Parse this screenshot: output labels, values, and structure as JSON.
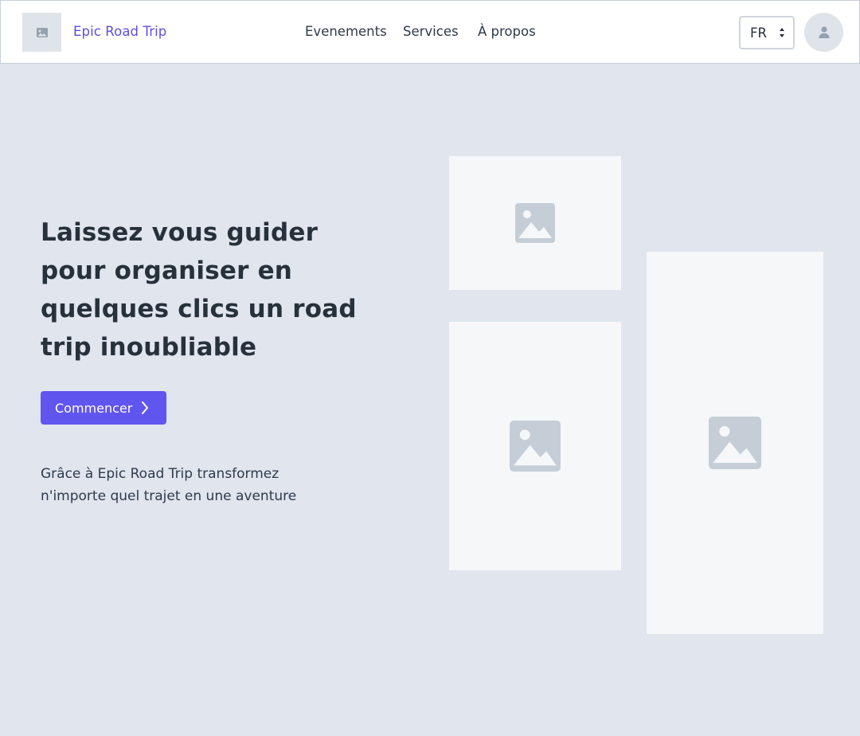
{
  "header": {
    "brand": "Epic Road Trip",
    "logo_icon": "image-placeholder-icon",
    "nav": [
      {
        "label": "Evenements"
      },
      {
        "label": "Services"
      },
      {
        "label": "À propos"
      }
    ],
    "language": {
      "selected": "FR",
      "icon": "sort-arrows-icon"
    },
    "avatar_icon": "user-icon"
  },
  "hero": {
    "title": "Laissez vous guider pour organiser en quelques clics un road trip inoubliable",
    "cta_label": "Commencer",
    "cta_icon": "chevron-right-icon",
    "subtitle": "Grâce à Epic Road Trip transformez n'importe quel trajet en une aventure"
  },
  "images": [
    {
      "icon": "image-placeholder-icon"
    },
    {
      "icon": "image-placeholder-icon"
    },
    {
      "icon": "image-placeholder-icon"
    }
  ],
  "colors": {
    "accent": "#6155f0",
    "brand_text": "#5b4fe0",
    "background": "#e0e5ee",
    "placeholder": "#c5ced7"
  }
}
